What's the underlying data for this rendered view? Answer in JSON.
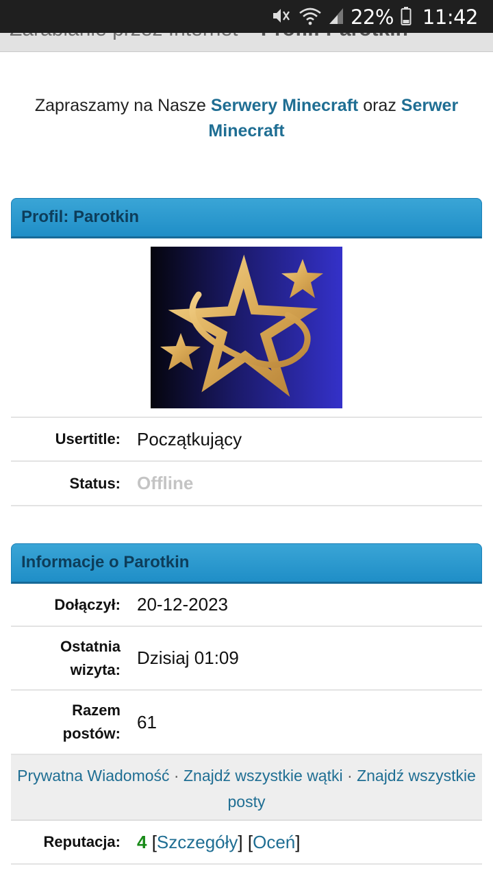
{
  "status_bar": {
    "battery_percent": "22%",
    "time": "11:42",
    "icons": [
      "mute-icon",
      "wifi-icon",
      "signal-icon",
      "battery-icon"
    ]
  },
  "header_peek": {
    "text": "Zarabianie przez Internet",
    "sep": " – ",
    "profile": "Profil: Parotkin"
  },
  "promo": {
    "prefix": "Zapraszamy na Nasze ",
    "link1": "Serwery Minecraft",
    "middle": " oraz ",
    "link2": "Serwer Minecraft"
  },
  "profile_panel": {
    "title": "Profil: Parotkin",
    "rows": [
      {
        "label": "Usertitle:",
        "value": "Początkujący"
      },
      {
        "label": "Status:",
        "value": "Offline"
      }
    ]
  },
  "info_panel": {
    "title": "Informacje o Parotkin",
    "rows": [
      {
        "label": "Dołączył:",
        "value": "20-12-2023"
      },
      {
        "label": "Ostatnia wizyta:",
        "value": "Dzisiaj 01:09"
      },
      {
        "label": "Razem postów:",
        "value": "61"
      }
    ],
    "links": {
      "private_message": "Prywatna Wiadomość",
      "find_threads": "Znajdź wszystkie wątki",
      "find_posts": "Znajdź wszystkie posty",
      "separator": " · "
    },
    "reputation": {
      "label": "Reputacja:",
      "value": "4",
      "details": "Szczegóły",
      "rate": "Oceń"
    }
  },
  "colors": {
    "link": "#1f6e93",
    "panel_header": "#2596cf",
    "reputation": "#188a18",
    "offline": "#c4c4c4"
  }
}
